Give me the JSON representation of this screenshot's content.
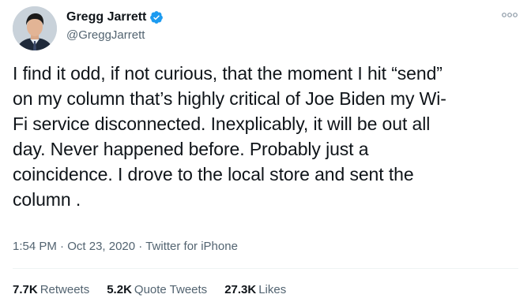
{
  "author": {
    "display_name": "Gregg Jarrett",
    "handle": "@GreggJarrett",
    "verified": true,
    "avatar_icon": "profile-photo"
  },
  "tweet": {
    "lines": [
      "I find it odd, if not curious, that the moment I hit “send”",
      "on my column that’s highly critical of Joe Biden my Wi-",
      "Fi service disconnected. Inexplicably, it will be out all",
      "day. Never happened before. Probably just a",
      "coincidence. I drove to the local store and sent the",
      "column ."
    ]
  },
  "meta": {
    "time": "1:54 PM",
    "date": "Oct 23, 2020",
    "source": "Twitter for iPhone",
    "separator": "·"
  },
  "stats": {
    "retweets_count": "7.7K",
    "retweets_label": "Retweets",
    "quotes_count": "5.2K",
    "quotes_label": "Quote Tweets",
    "likes_count": "27.3K",
    "likes_label": "Likes"
  },
  "colors": {
    "verified_badge": "#1d9bf0",
    "secondary_text": "#536471",
    "primary_text": "#0f1419"
  }
}
